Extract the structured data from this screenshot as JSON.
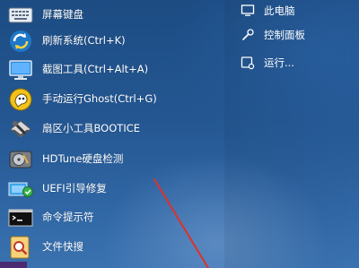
{
  "left_menu": {
    "items": [
      {
        "label": "屏幕键盘",
        "icon": "keyboard-icon"
      },
      {
        "label": "刷新系统(Ctrl+K)",
        "icon": "refresh-icon"
      },
      {
        "label": "截图工具(Ctrl+Alt+A)",
        "icon": "screenshot-icon"
      },
      {
        "label": "手动运行Ghost(Ctrl+G)",
        "icon": "ghost-icon"
      },
      {
        "label": "扇区小工具BOOTICE",
        "icon": "disk-tool-icon"
      },
      {
        "label": "HDTune硬盘检测",
        "icon": "hard-drive-icon"
      },
      {
        "label": "UEFI引导修复",
        "icon": "uefi-repair-icon"
      },
      {
        "label": "命令提示符",
        "icon": "command-prompt-icon"
      },
      {
        "label": "文件快搜",
        "icon": "file-search-icon"
      }
    ]
  },
  "right_menu": {
    "items": [
      {
        "label": "此电脑",
        "icon": "computer-icon"
      },
      {
        "label": "控制面板",
        "icon": "wrench-icon"
      },
      {
        "label": "运行...",
        "icon": "run-icon"
      }
    ]
  },
  "colors": {
    "background": "#245792",
    "laser": "#e0302a"
  }
}
